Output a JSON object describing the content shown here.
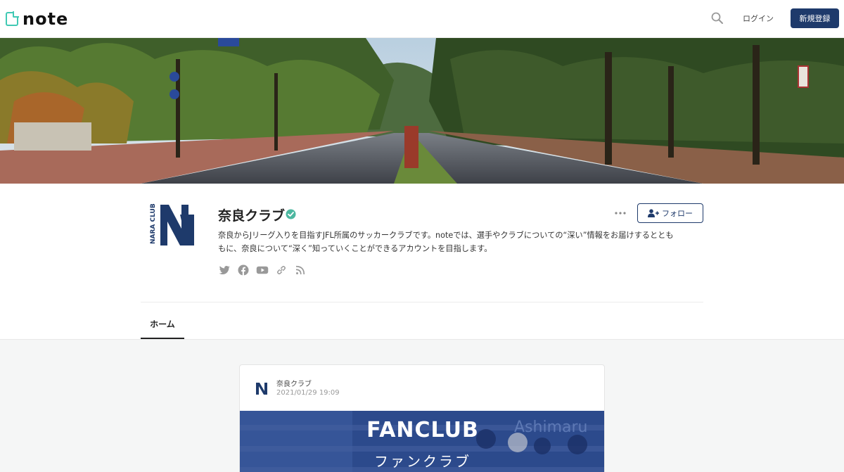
{
  "header": {
    "logo_text": "note",
    "login_label": "ログイン",
    "signup_label": "新規登録"
  },
  "profile": {
    "logo_text": "NARA CLUB",
    "name": "奈良クラブ",
    "follow_label": "フォロー",
    "description_line1": "奈良からJリーグ入りを目指すJFL所属のサッカークラブです。noteでは、選手やクラブについての“深い”情報をお届けするととも",
    "description_line2": "もに、奈良について“深く”知っていくことができるアカウントを目指します。",
    "social_icons": [
      "twitter-icon",
      "facebook-icon",
      "youtube-icon",
      "link-icon",
      "rss-icon"
    ]
  },
  "tabs": {
    "home_label": "ホーム"
  },
  "post": {
    "author": "奈良クラブ",
    "date": "2021/01/29 19:09",
    "image_title": "FANCLUB",
    "image_subtitle": "ファンクラブ",
    "image_bg_text": "Ashimaru"
  },
  "colors": {
    "brand_navy": "#1e3a6b",
    "note_green": "#41c9b4",
    "verified": "#4cb7a0",
    "feed_bg": "#f5f6f6"
  }
}
